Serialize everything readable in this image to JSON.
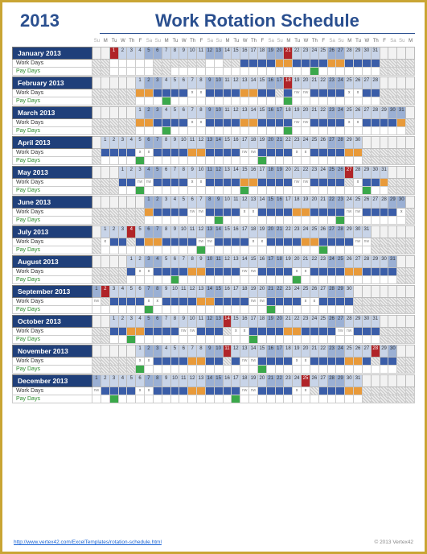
{
  "header": {
    "year": "2013",
    "title": "Work Rotation Schedule"
  },
  "dow": [
    "Su",
    "M",
    "Tu",
    "W",
    "Th",
    "F",
    "Sa",
    "Su",
    "M",
    "Tu",
    "W",
    "Th",
    "F",
    "Sa",
    "Su",
    "M",
    "Tu",
    "W",
    "Th",
    "F",
    "Sa",
    "Su",
    "M",
    "Tu",
    "W",
    "Th",
    "F",
    "Sa",
    "Su",
    "M",
    "Tu",
    "W",
    "Th",
    "F",
    "Sa",
    "Su",
    "M"
  ],
  "row_labels": {
    "work": "Work Days",
    "pay": "Pay Days"
  },
  "footer": {
    "url": "http://www.vertex42.com/ExcelTemplates/rotation-schedule.html",
    "copy": "© 2013 Vertex42"
  },
  "months": [
    {
      "name": "January 2013",
      "offset": 2,
      "days": 31,
      "holidays": [
        1,
        21
      ],
      "work": [
        "h",
        "h",
        "",
        "",
        "",
        "",
        "",
        "h",
        "h",
        "h",
        "h",
        "h",
        "h",
        "",
        "",
        "h",
        "h",
        "b",
        "b",
        "b",
        "b",
        "o",
        "o",
        "b",
        "b",
        "b",
        "b",
        "o",
        "o",
        "b",
        "b",
        "b",
        "b",
        "h",
        "h",
        "h",
        "h"
      ],
      "pay": [
        "h",
        "h",
        "",
        "",
        "",
        "",
        "",
        "h",
        "h",
        "",
        "",
        "",
        "",
        "",
        "",
        "",
        "",
        "",
        "",
        "",
        "",
        "",
        "",
        "",
        "",
        "g",
        "",
        "",
        "",
        "",
        "",
        "",
        "",
        "h",
        "h",
        "h",
        "h"
      ]
    },
    {
      "name": "February 2013",
      "offset": 5,
      "days": 28,
      "holidays": [
        18
      ],
      "work": [
        "h",
        "h",
        "h",
        "h",
        "h",
        "o",
        "o",
        "b",
        "b",
        "b",
        "b",
        "x",
        "x",
        "b",
        "b",
        "b",
        "b",
        "o",
        "o",
        "b",
        "b",
        "h",
        "b",
        "nw",
        "nw",
        "b",
        "b",
        "b",
        "b",
        "x",
        "x",
        "b",
        "b",
        "h",
        "h",
        "h",
        "h"
      ],
      "pay": [
        "h",
        "h",
        "h",
        "h",
        "h",
        "",
        "",
        "",
        "g",
        "",
        "",
        "",
        "",
        "",
        "",
        "",
        "",
        "",
        "",
        "",
        "",
        "",
        "g",
        "",
        "",
        "",
        "",
        "",
        "",
        "",
        "",
        "",
        "",
        "h",
        "h",
        "h",
        "h"
      ]
    },
    {
      "name": "March 2013",
      "offset": 5,
      "days": 31,
      "holidays": [],
      "work": [
        "h",
        "h",
        "h",
        "h",
        "h",
        "o",
        "o",
        "b",
        "b",
        "b",
        "b",
        "x",
        "x",
        "b",
        "b",
        "b",
        "b",
        "o",
        "o",
        "b",
        "b",
        "b",
        "b",
        "nw",
        "nw",
        "b",
        "b",
        "b",
        "b",
        "x",
        "x",
        "b",
        "b",
        "b",
        "b",
        "o",
        "h"
      ],
      "pay": [
        "h",
        "h",
        "h",
        "h",
        "h",
        "",
        "",
        "",
        "g",
        "",
        "",
        "",
        "",
        "",
        "",
        "",
        "",
        "",
        "",
        "",
        "",
        "",
        "g",
        "",
        "",
        "",
        "",
        "",
        "",
        "",
        "",
        "",
        "",
        "",
        "",
        "",
        "h"
      ]
    },
    {
      "name": "April 2013",
      "offset": 1,
      "days": 30,
      "holidays": [],
      "work": [
        "h",
        "b",
        "b",
        "b",
        "b",
        "x",
        "x",
        "b",
        "b",
        "b",
        "b",
        "o",
        "o",
        "b",
        "b",
        "b",
        "b",
        "nw",
        "nw",
        "b",
        "b",
        "b",
        "b",
        "x",
        "x",
        "b",
        "b",
        "b",
        "b",
        "o",
        "o",
        "h",
        "h",
        "h",
        "h",
        "h",
        "h"
      ],
      "pay": [
        "h",
        "",
        "",
        "",
        "",
        "g",
        "",
        "",
        "",
        "",
        "",
        "",
        "",
        "",
        "",
        "",
        "",
        "",
        "",
        "g",
        "",
        "",
        "",
        "",
        "",
        "",
        "",
        "",
        "",
        "",
        "",
        "h",
        "h",
        "h",
        "h",
        "h",
        "h"
      ]
    },
    {
      "name": "May 2013",
      "offset": 3,
      "days": 31,
      "holidays": [
        27
      ],
      "work": [
        "h",
        "h",
        "h",
        "b",
        "b",
        "nw",
        "nw",
        "b",
        "b",
        "b",
        "b",
        "x",
        "x",
        "b",
        "b",
        "b",
        "b",
        "o",
        "o",
        "b",
        "b",
        "b",
        "b",
        "nw",
        "nw",
        "b",
        "b",
        "b",
        "b",
        "h",
        "x",
        "b",
        "b",
        "o",
        "h",
        "h",
        "h"
      ],
      "pay": [
        "h",
        "h",
        "h",
        "",
        "",
        "g",
        "",
        "",
        "",
        "",
        "",
        "",
        "",
        "",
        "",
        "",
        "",
        "g",
        "",
        "",
        "",
        "",
        "",
        "",
        "",
        "",
        "",
        "",
        "",
        "",
        "",
        "g",
        "",
        "",
        "h",
        "h",
        "h"
      ]
    },
    {
      "name": "June 2013",
      "offset": 6,
      "days": 30,
      "holidays": [],
      "work": [
        "h",
        "h",
        "h",
        "h",
        "h",
        "h",
        "o",
        "b",
        "b",
        "b",
        "b",
        "nw",
        "nw",
        "b",
        "b",
        "b",
        "b",
        "x",
        "x",
        "b",
        "b",
        "b",
        "b",
        "o",
        "o",
        "b",
        "b",
        "b",
        "b",
        "nw",
        "nw",
        "b",
        "b",
        "b",
        "b",
        "x",
        "h"
      ],
      "pay": [
        "h",
        "h",
        "h",
        "h",
        "h",
        "h",
        "",
        "",
        "",
        "",
        "",
        "",
        "",
        "",
        "g",
        "",
        "",
        "",
        "",
        "",
        "",
        "",
        "",
        "",
        "",
        "",
        "",
        "",
        "g",
        "",
        "",
        "",
        "",
        "",
        "",
        "",
        "h"
      ]
    },
    {
      "name": "July 2013",
      "offset": 1,
      "days": 31,
      "holidays": [
        4
      ],
      "work": [
        "h",
        "x",
        "b",
        "b",
        "h",
        "b",
        "o",
        "o",
        "b",
        "b",
        "b",
        "b",
        "nw",
        "nw",
        "b",
        "b",
        "b",
        "b",
        "x",
        "x",
        "b",
        "b",
        "b",
        "b",
        "o",
        "o",
        "b",
        "b",
        "b",
        "b",
        "nw",
        "nw",
        "h",
        "h",
        "h",
        "h",
        "h"
      ],
      "pay": [
        "h",
        "",
        "",
        "",
        "",
        "",
        "",
        "",
        "",
        "",
        "",
        "",
        "g",
        "",
        "",
        "",
        "",
        "",
        "",
        "",
        "",
        "",
        "",
        "",
        "",
        "",
        "g",
        "",
        "",
        "",
        "",
        "",
        "h",
        "h",
        "h",
        "h",
        "h"
      ]
    },
    {
      "name": "August 2013",
      "offset": 4,
      "days": 31,
      "holidays": [],
      "work": [
        "h",
        "h",
        "h",
        "h",
        "b",
        "x",
        "x",
        "b",
        "b",
        "b",
        "b",
        "o",
        "o",
        "b",
        "b",
        "b",
        "b",
        "nw",
        "nw",
        "b",
        "b",
        "b",
        "b",
        "x",
        "x",
        "b",
        "b",
        "b",
        "b",
        "o",
        "o",
        "b",
        "b",
        "b",
        "b",
        "h",
        "h"
      ],
      "pay": [
        "h",
        "h",
        "h",
        "h",
        "",
        "",
        "",
        "",
        "",
        "g",
        "",
        "",
        "",
        "",
        "",
        "",
        "",
        "",
        "",
        "",
        "",
        "",
        "",
        "g",
        "",
        "",
        "",
        "",
        "",
        "",
        "",
        "",
        "",
        "",
        "",
        "h",
        "h"
      ]
    },
    {
      "name": "September 2013",
      "offset": 0,
      "days": 30,
      "holidays": [
        2
      ],
      "work": [
        "nw",
        "h",
        "b",
        "b",
        "b",
        "b",
        "x",
        "x",
        "b",
        "b",
        "b",
        "b",
        "o",
        "o",
        "b",
        "b",
        "b",
        "b",
        "nw",
        "nw",
        "b",
        "b",
        "b",
        "b",
        "x",
        "x",
        "b",
        "b",
        "b",
        "b",
        "h",
        "h",
        "h",
        "h",
        "h",
        "h",
        "h"
      ],
      "pay": [
        "",
        "",
        "",
        "",
        "",
        "",
        "g",
        "",
        "",
        "",
        "",
        "",
        "",
        "",
        "",
        "",
        "",
        "",
        "",
        "",
        "g",
        "",
        "",
        "",
        "",
        "",
        "",
        "",
        "",
        "",
        "h",
        "h",
        "h",
        "h",
        "h",
        "h",
        "h"
      ]
    },
    {
      "name": "October 2013",
      "offset": 2,
      "days": 31,
      "holidays": [
        14
      ],
      "work": [
        "h",
        "h",
        "b",
        "b",
        "o",
        "o",
        "b",
        "b",
        "b",
        "b",
        "nw",
        "nw",
        "b",
        "b",
        "b",
        "h",
        "x",
        "x",
        "b",
        "b",
        "b",
        "b",
        "o",
        "o",
        "b",
        "b",
        "b",
        "b",
        "nw",
        "nw",
        "b",
        "b",
        "b",
        "h",
        "h",
        "h",
        "h"
      ],
      "pay": [
        "h",
        "h",
        "",
        "",
        "g",
        "",
        "",
        "",
        "",
        "",
        "",
        "",
        "",
        "",
        "",
        "",
        "",
        "",
        "g",
        "",
        "",
        "",
        "",
        "",
        "",
        "",
        "",
        "",
        "",
        "",
        "",
        "",
        "",
        "h",
        "h",
        "h",
        "h"
      ]
    },
    {
      "name": "November 2013",
      "offset": 5,
      "days": 30,
      "holidays": [
        11,
        28
      ],
      "work": [
        "h",
        "h",
        "h",
        "h",
        "h",
        "x",
        "x",
        "b",
        "b",
        "b",
        "b",
        "o",
        "o",
        "b",
        "b",
        "h",
        "b",
        "nw",
        "nw",
        "b",
        "b",
        "b",
        "b",
        "x",
        "x",
        "b",
        "b",
        "b",
        "b",
        "o",
        "o",
        "b",
        "h",
        "b",
        "b",
        "h",
        "h"
      ],
      "pay": [
        "h",
        "h",
        "h",
        "h",
        "h",
        "g",
        "",
        "",
        "",
        "",
        "",
        "",
        "",
        "",
        "",
        "",
        "",
        "",
        "",
        "g",
        "",
        "",
        "",
        "",
        "",
        "",
        "",
        "",
        "",
        "",
        "",
        "",
        "",
        "",
        "",
        "h",
        "h"
      ]
    },
    {
      "name": "December 2013",
      "offset": 0,
      "days": 31,
      "holidays": [
        25
      ],
      "work": [
        "nw",
        "b",
        "b",
        "b",
        "b",
        "x",
        "x",
        "b",
        "b",
        "b",
        "b",
        "o",
        "o",
        "b",
        "b",
        "b",
        "b",
        "nw",
        "nw",
        "b",
        "b",
        "b",
        "b",
        "x",
        "x",
        "h",
        "b",
        "b",
        "b",
        "o",
        "o",
        "h",
        "h",
        "h",
        "h",
        "h",
        "h"
      ],
      "pay": [
        "",
        "",
        "g",
        "",
        "",
        "",
        "",
        "",
        "",
        "",
        "",
        "",
        "",
        "",
        "",
        "",
        "g",
        "",
        "",
        "",
        "",
        "",
        "",
        "",
        "",
        "",
        "",
        "",
        "",
        "",
        "",
        "h",
        "h",
        "h",
        "h",
        "h",
        "h"
      ]
    }
  ]
}
